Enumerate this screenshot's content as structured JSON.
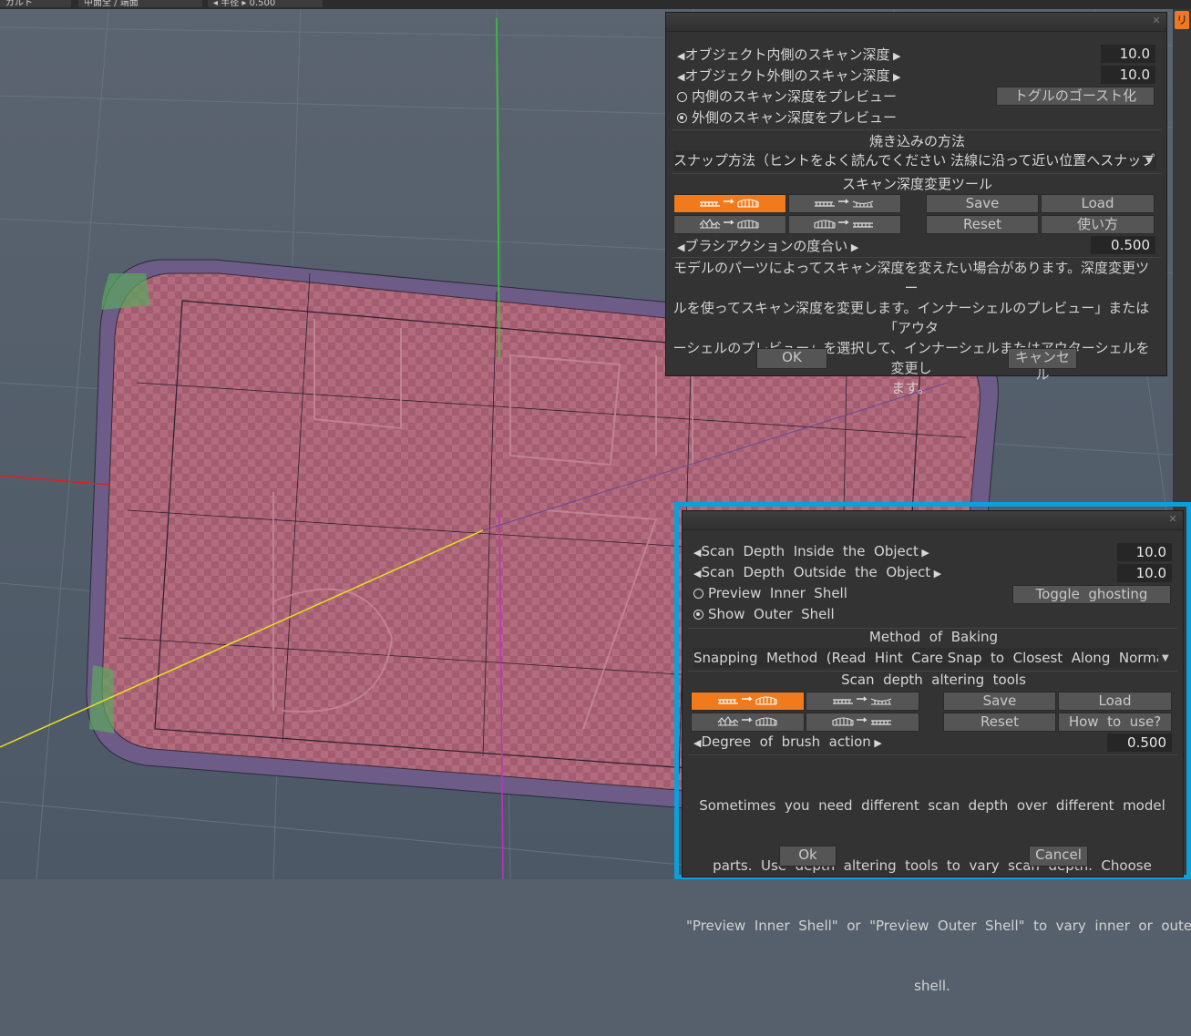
{
  "toolbar": {
    "item1": "ガルト",
    "item2": "中面全 / 端面",
    "item3": "◂ 半径 ▸",
    "item3_value": "0.500",
    "right_tab": "リ"
  },
  "dialog_jp": {
    "scan_inside_label": "オブジェクト内側のスキャン深度",
    "scan_inside_value": "10.0",
    "scan_outside_label": "オブジェクト外側のスキャン深度",
    "scan_outside_value": "10.0",
    "preview_inner": "内側のスキャン深度をプレビュー",
    "preview_outer": "外側のスキャン深度をプレビュー",
    "toggle_ghost": "トグルのゴースト化",
    "bake_title": "焼き込みの方法",
    "snap_method": "スナップ方法（ヒントをよく読んでください 法線に沿って近い位置へスナップ",
    "tools_title": "スキャン深度変更ツール",
    "save": "Save",
    "load": "Load",
    "reset": "Reset",
    "howto": "使い方",
    "brush_label": "ブラシアクションの度合い",
    "brush_value": "0.500",
    "desc1": "モデルのパーツによってスキャン深度を変えたい場合があります。深度変更ツー",
    "desc2": "ルを使ってスキャン深度を変更します。インナーシェルのプレビュー」または「アウタ",
    "desc3": "ーシェルのプレビュー」を選択して、インナーシェルまたはアウターシェルを変更し",
    "desc4": "ます。",
    "ok": "OK",
    "cancel": "キャンセル"
  },
  "dialog_en": {
    "scan_inside_label": "Scan  Depth  Inside  the  Object",
    "scan_inside_value": "10.0",
    "scan_outside_label": "Scan  Depth  Outside  the  Object",
    "scan_outside_value": "10.0",
    "preview_inner": "Preview  Inner  Shell",
    "preview_outer": "Show  Outer  Shell",
    "toggle_ghost": "Toggle  ghosting",
    "bake_title": "Method  of  Baking",
    "snap_method": "Snapping  Method  (Read  Hint  Care Snap  to  Closest  Along  Normal",
    "tools_title": "Scan  depth  altering  tools",
    "save": "Save",
    "load": "Load",
    "reset": "Reset",
    "howto": "How  to  use?",
    "brush_label": "Degree  of  brush  action",
    "brush_value": "0.500",
    "desc1": "Sometimes  you  need  different  scan  depth  over  different  model",
    "desc2": "parts.  Use  depth  altering  tools  to  vary  scan  depth.  Choose",
    "desc3": "\"Preview  Inner  Shell\"  or  \"Preview  Outer  Shell\"  to  vary  inner  or  outer",
    "desc4": "shell.",
    "ok": "Ok",
    "cancel": "Cancel"
  },
  "plate_text": {
    "top": "山梨 501",
    "bottom": "す 5 1-7"
  },
  "colors": {
    "accent": "#f07a1c",
    "highlight": "#0aa0dc",
    "dialog_bg": "#333333",
    "viewport_bg": "#55606c",
    "plate": "#b06a7c"
  }
}
